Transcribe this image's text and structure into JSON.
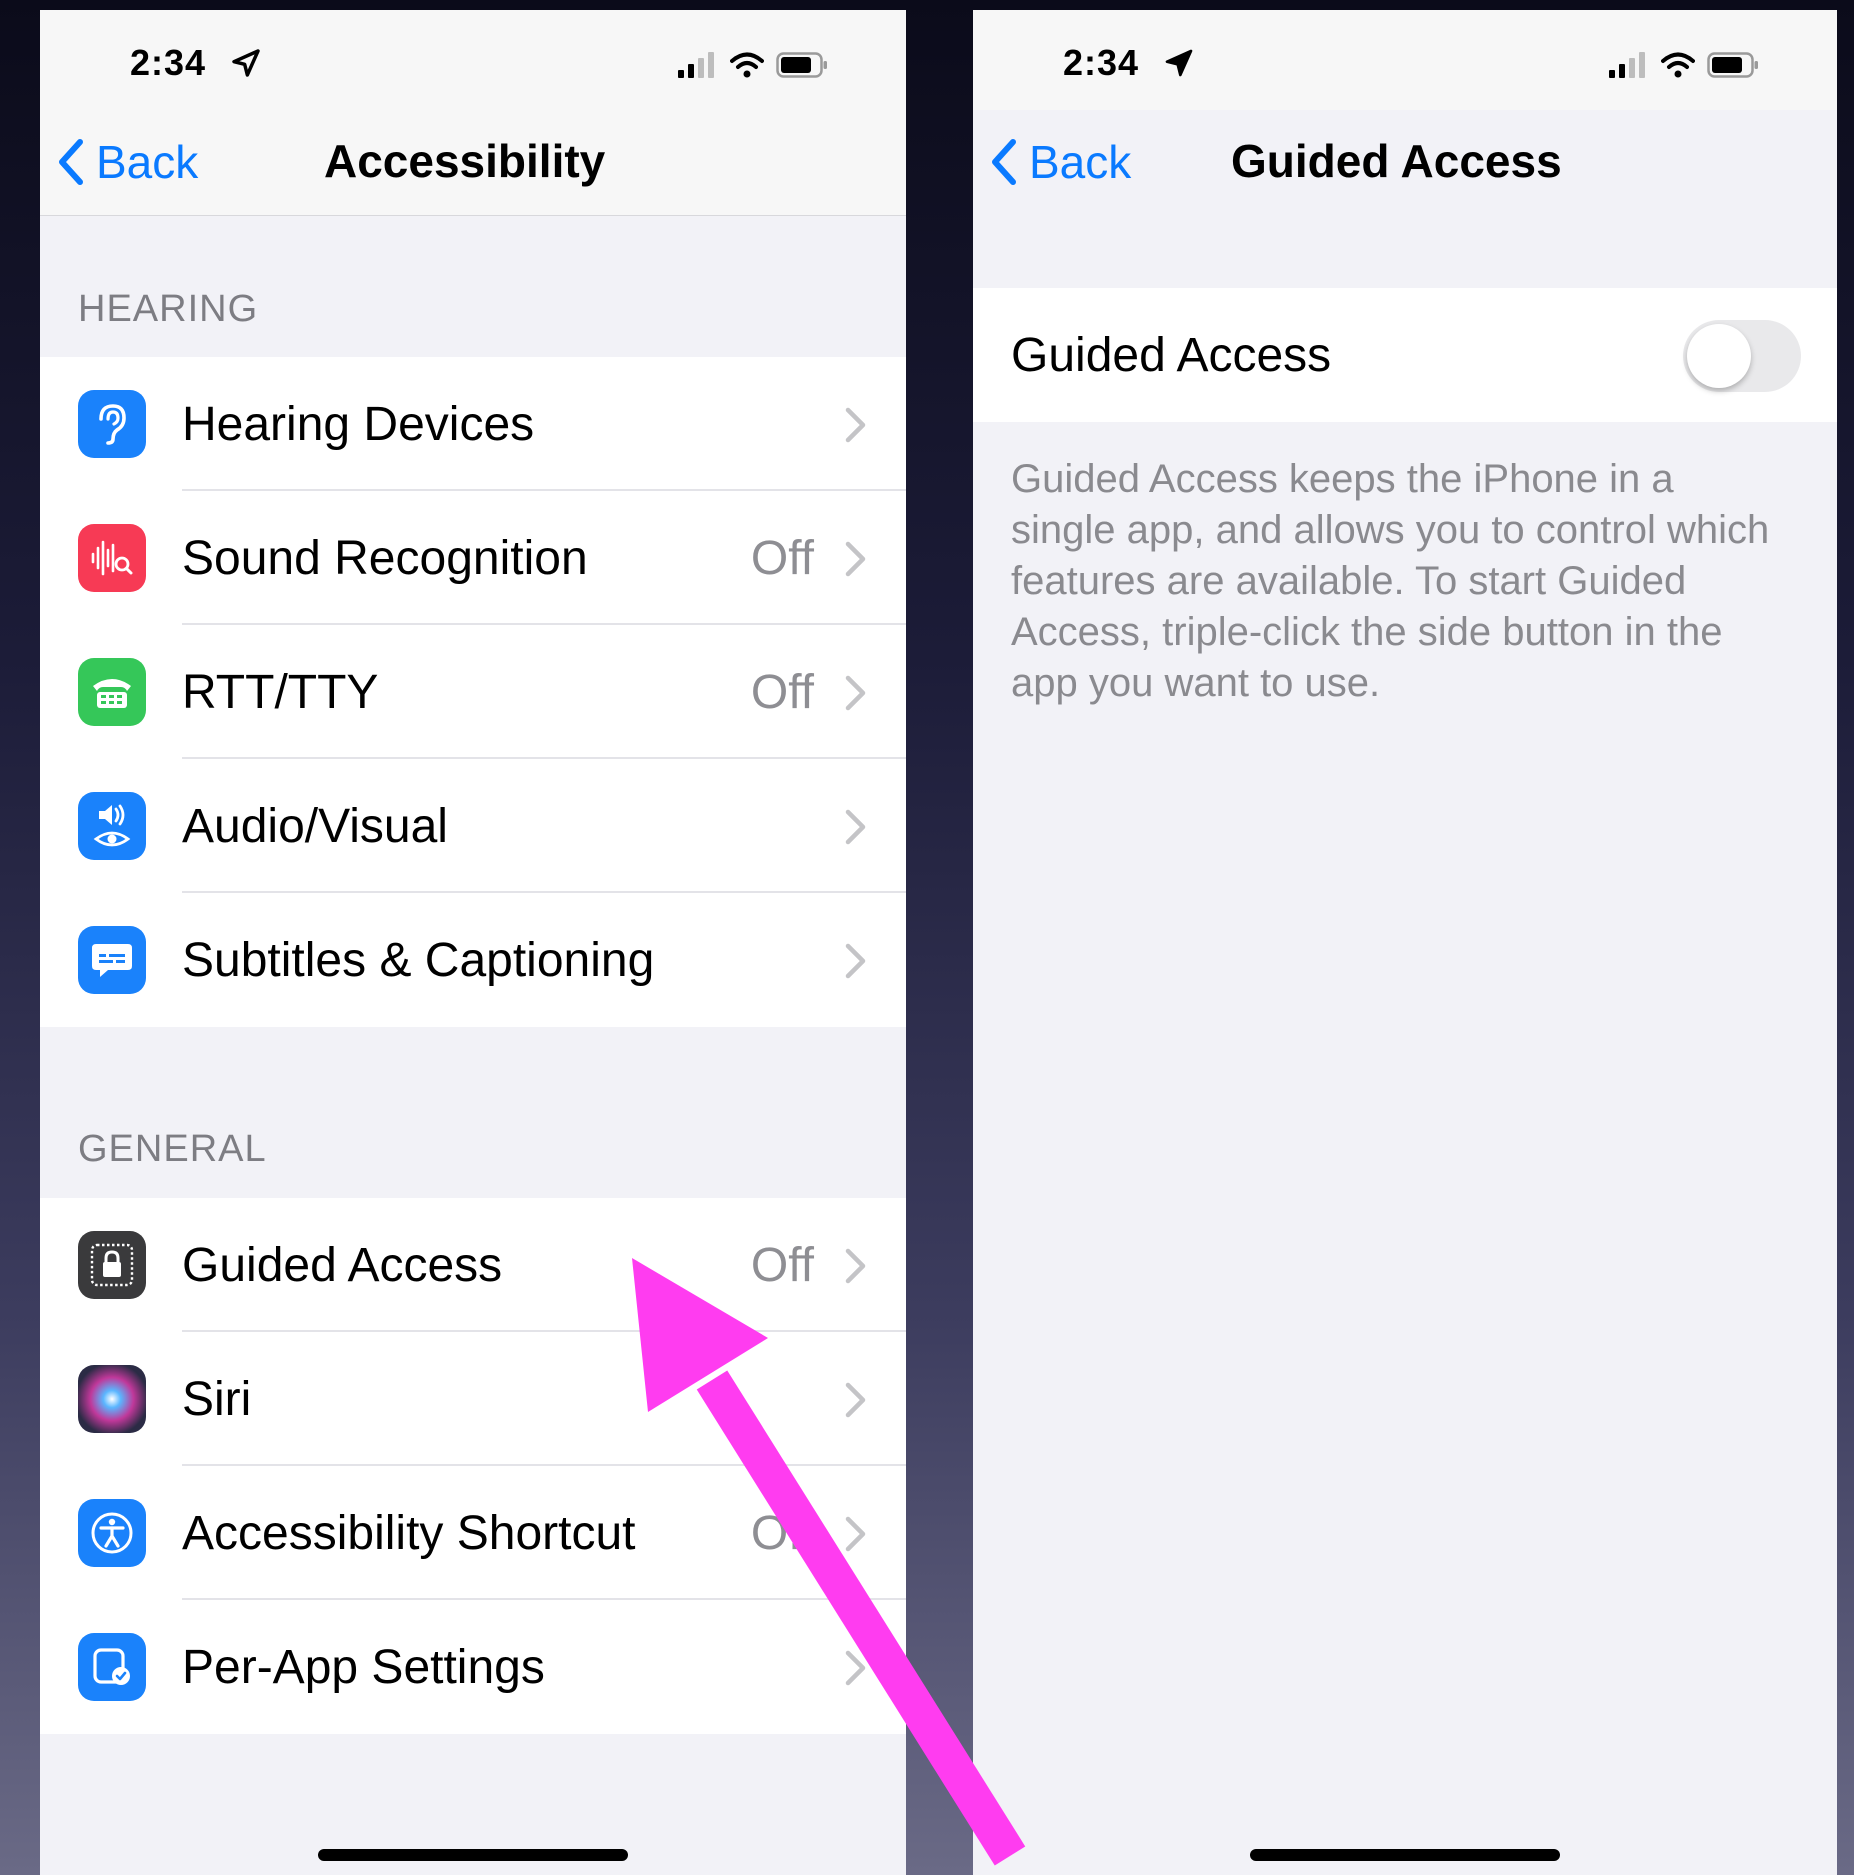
{
  "left_screen": {
    "status": {
      "time": "2:34"
    },
    "nav": {
      "back_label": "Back",
      "title": "Accessibility"
    },
    "hearing": {
      "header": "HEARING",
      "items": [
        {
          "label": "Hearing Devices",
          "value": "",
          "icon": "ear-icon",
          "color": "#1a82fb"
        },
        {
          "label": "Sound Recognition",
          "value": "Off",
          "icon": "sound-recognition-icon",
          "color": "#f73a55"
        },
        {
          "label": "RTT/TTY",
          "value": "Off",
          "icon": "rtt-tty-icon",
          "color": "#35c759"
        },
        {
          "label": "Audio/Visual",
          "value": "",
          "icon": "audio-visual-icon",
          "color": "#1a82fb"
        },
        {
          "label": "Subtitles & Captioning",
          "value": "",
          "icon": "subtitles-icon",
          "color": "#1a82fb"
        }
      ]
    },
    "general": {
      "header": "GENERAL",
      "items": [
        {
          "label": "Guided Access",
          "value": "Off",
          "icon": "lock-icon",
          "color": "#3a3a3c"
        },
        {
          "label": "Siri",
          "value": "",
          "icon": "siri-icon",
          "color": "#2b2b45"
        },
        {
          "label": "Accessibility Shortcut",
          "value": "Off",
          "icon": "accessibility-icon",
          "color": "#1a82fb"
        },
        {
          "label": "Per-App Settings",
          "value": "",
          "icon": "per-app-settings-icon",
          "color": "#1a82fb"
        }
      ]
    }
  },
  "right_screen": {
    "status": {
      "time": "2:34"
    },
    "nav": {
      "back_label": "Back",
      "title": "Guided Access"
    },
    "toggle_row": {
      "label": "Guided Access",
      "state": "off"
    },
    "footnote": "Guided Access keeps the iPhone in a single app, and allows you to control which features are available. To start Guided Access, triple-click the side button in the app you want to use."
  },
  "colors": {
    "accent": "#0a7aff",
    "annotation_arrow": "#ff3cf0"
  }
}
